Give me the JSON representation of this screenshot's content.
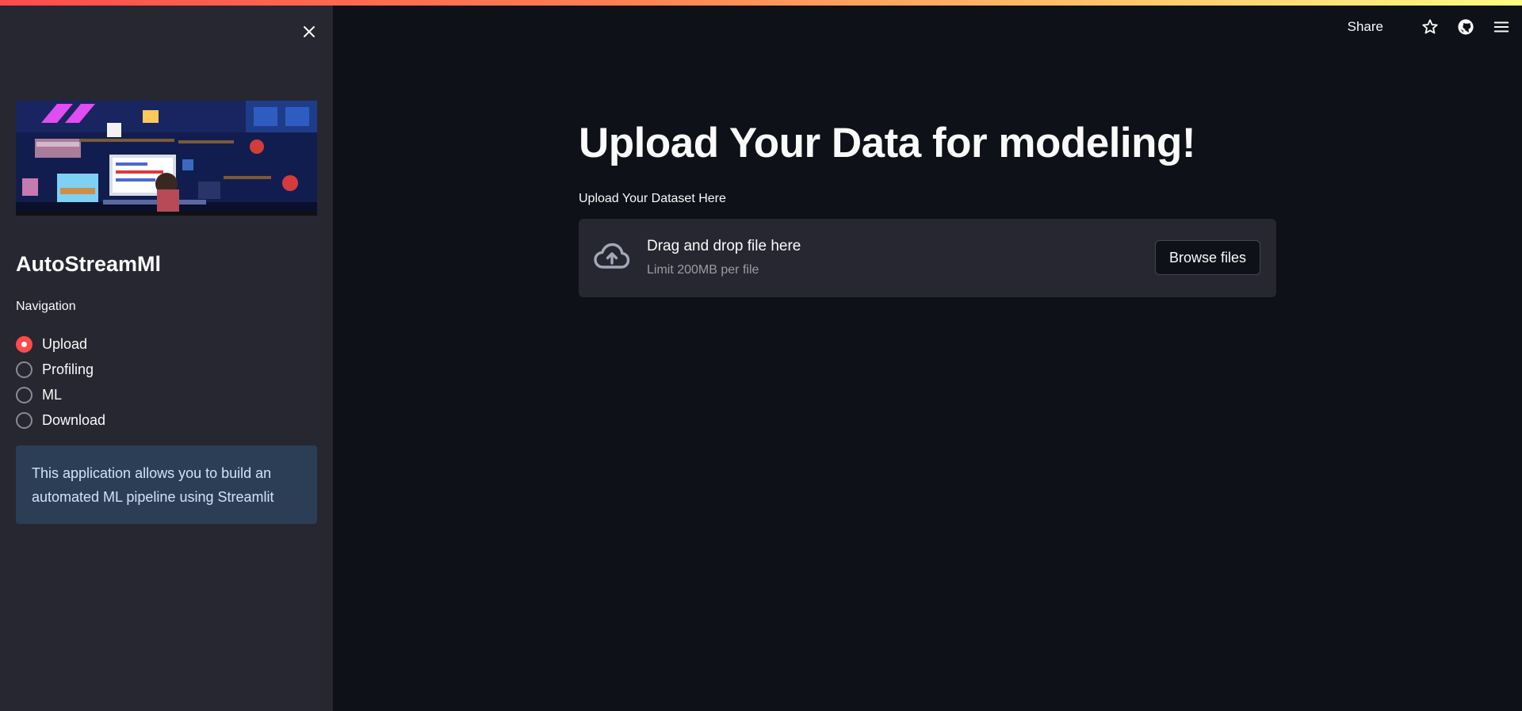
{
  "header": {
    "share_label": "Share",
    "icons": [
      "star-icon",
      "github-icon",
      "hamburger-menu-icon"
    ]
  },
  "sidebar": {
    "close_icon": "close-icon",
    "banner_image": "pixel-art-retro-gaming-room",
    "title": "AutoStreamMl",
    "nav_label": "Navigation",
    "nav_options": [
      {
        "label": "Upload",
        "selected": true
      },
      {
        "label": "Profiling",
        "selected": false
      },
      {
        "label": "ML",
        "selected": false
      },
      {
        "label": "Download",
        "selected": false
      }
    ],
    "info_text_line1": "This application allows you to build an",
    "info_text_line2": "automated ML pipeline using Streamlit"
  },
  "main": {
    "title": "Upload Your Data for modeling!",
    "uploader": {
      "label": "Upload Your Dataset Here",
      "drop_text": "Drag and drop file here",
      "limit_text": "Limit 200MB per file",
      "browse_label": "Browse files",
      "icon": "cloud-upload-icon"
    }
  },
  "colors": {
    "background": "#0e1117",
    "sidebar": "#262730",
    "accent": "#ff4b4b",
    "info_box": "#2c3e55",
    "info_text": "#cfe3fa"
  }
}
